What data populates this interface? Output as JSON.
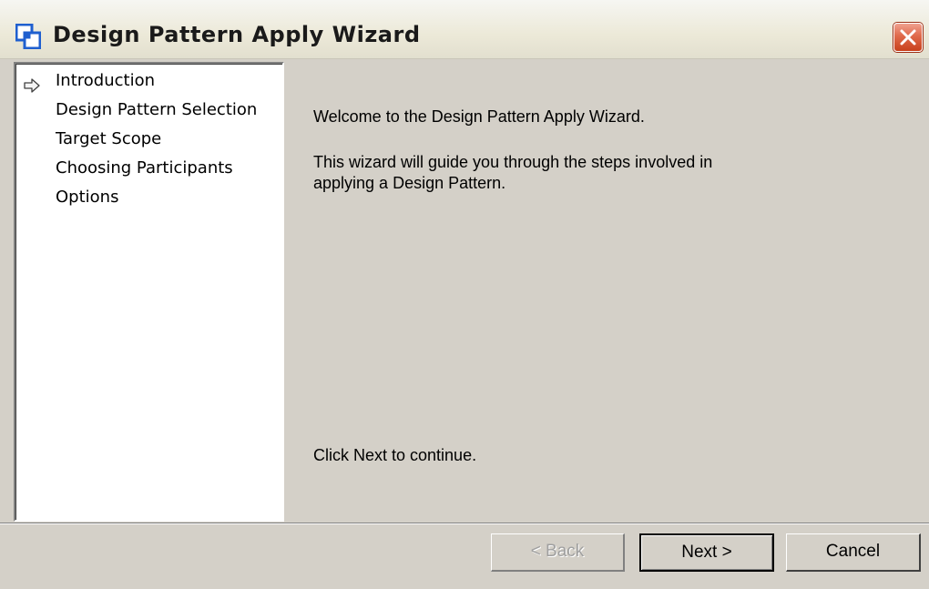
{
  "window": {
    "title": "Design Pattern Apply Wizard"
  },
  "steps": [
    {
      "label": "Introduction",
      "current": true
    },
    {
      "label": "Design Pattern Selection",
      "current": false
    },
    {
      "label": "Target Scope",
      "current": false
    },
    {
      "label": "Choosing Participants",
      "current": false
    },
    {
      "label": "Options",
      "current": false
    }
  ],
  "content": {
    "welcome": "Welcome to the Design Pattern Apply Wizard.",
    "description_line1": "This wizard will guide you through the steps involved in",
    "description_line2": "applying a Design Pattern.",
    "instruction": "Click Next to continue."
  },
  "buttons": {
    "back_label": "< Back",
    "back_enabled": false,
    "next_label": "Next >",
    "cancel_label": "Cancel"
  },
  "icons": {
    "app": "design-pattern-icon",
    "close": "close-icon",
    "current_step": "arrow-right-icon"
  },
  "colors": {
    "close_button": "#e06a4b",
    "app_icon": "#1f5fcf"
  }
}
